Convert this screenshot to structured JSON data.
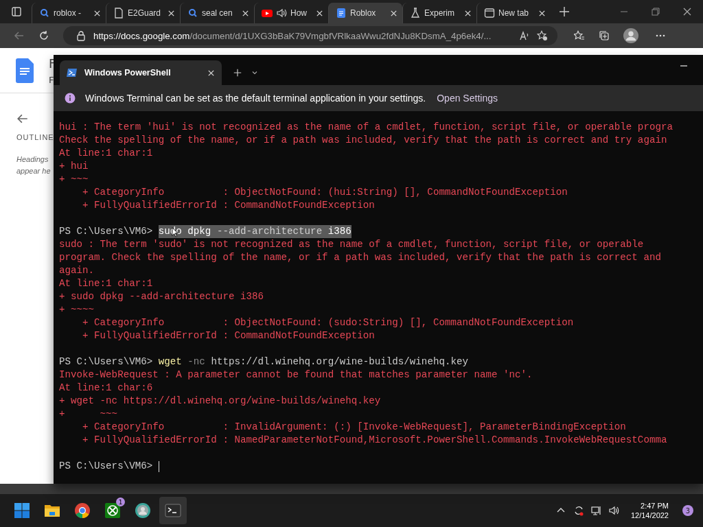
{
  "browser": {
    "tabs": [
      {
        "title": "roblox -",
        "kind": "search",
        "selected": false
      },
      {
        "title": "E2Guard",
        "kind": "page",
        "selected": false
      },
      {
        "title": "seal cen",
        "kind": "search",
        "selected": false
      },
      {
        "title": "How",
        "kind": "video",
        "selected": false
      },
      {
        "title": "Roblox",
        "kind": "doc",
        "selected": true
      },
      {
        "title": "Experim",
        "kind": "flask",
        "selected": false
      },
      {
        "title": "New tab",
        "kind": "newtab",
        "selected": false
      }
    ],
    "url_host": "https://docs.google.com",
    "url_path": "/document/d/1UXG3bBaK79VmgbfVRlkaaWwu2fdNJu8KDsmA_4p6ek4/..."
  },
  "docs": {
    "title_fragment": "F",
    "menu_fragment": "F",
    "outline_label": "OUTLINE",
    "outline_hint": [
      "Headings",
      "appear he"
    ]
  },
  "terminal": {
    "tab_title": "Windows PowerShell",
    "info": "Windows Terminal can be set as the default terminal application in your settings.",
    "info_action": "Open Settings",
    "lines": [
      {
        "kind": "error",
        "text": "hui : The term 'hui' is not recognized as the name of a cmdlet, function, script file, or operable progra"
      },
      {
        "kind": "error",
        "text": "Check the spelling of the name, or if a path was included, verify that the path is correct and try again"
      },
      {
        "kind": "error",
        "text": "At line:1 char:1"
      },
      {
        "kind": "error",
        "text": "+ hui"
      },
      {
        "kind": "error",
        "text": "+ ~~~"
      },
      {
        "kind": "error",
        "text": "    + CategoryInfo          : ObjectNotFound: (hui:String) [], CommandNotFoundException"
      },
      {
        "kind": "error",
        "text": "    + FullyQualifiedErrorId : CommandNotFoundException"
      },
      {
        "kind": "blank"
      },
      {
        "kind": "prompt",
        "prompt": "PS C:\\Users\\VM6>",
        "selected": true,
        "parts": [
          {
            "kind": "cmd",
            "text": "sudo"
          },
          {
            "kind": "arg",
            "text": "dpkg"
          },
          {
            "kind": "param",
            "text": "--add-architecture"
          },
          {
            "kind": "arg",
            "text": "i386"
          }
        ]
      },
      {
        "kind": "error",
        "text": "sudo : The term 'sudo' is not recognized as the name of a cmdlet, function, script file, or operable"
      },
      {
        "kind": "error",
        "text": "program. Check the spelling of the name, or if a path was included, verify that the path is correct and"
      },
      {
        "kind": "error",
        "text": "again."
      },
      {
        "kind": "error",
        "text": "At line:1 char:1"
      },
      {
        "kind": "error",
        "text": "+ sudo dpkg --add-architecture i386"
      },
      {
        "kind": "error",
        "text": "+ ~~~~"
      },
      {
        "kind": "error",
        "text": "    + CategoryInfo          : ObjectNotFound: (sudo:String) [], CommandNotFoundException"
      },
      {
        "kind": "error",
        "text": "    + FullyQualifiedErrorId : CommandNotFoundException"
      },
      {
        "kind": "blank"
      },
      {
        "kind": "prompt",
        "prompt": "PS C:\\Users\\VM6>",
        "selected": false,
        "parts": [
          {
            "kind": "cmd",
            "text": "wget"
          },
          {
            "kind": "param",
            "text": "-nc"
          },
          {
            "kind": "arg",
            "text": "https://dl.winehq.org/wine-builds/winehq.key"
          }
        ]
      },
      {
        "kind": "error",
        "text": "Invoke-WebRequest : A parameter cannot be found that matches parameter name 'nc'."
      },
      {
        "kind": "error",
        "text": "At line:1 char:6"
      },
      {
        "kind": "error",
        "text": "+ wget -nc https://dl.winehq.org/wine-builds/winehq.key"
      },
      {
        "kind": "error",
        "text": "+      ~~~"
      },
      {
        "kind": "error",
        "text": "    + CategoryInfo          : InvalidArgument: (:) [Invoke-WebRequest], ParameterBindingException"
      },
      {
        "kind": "error",
        "text": "    + FullyQualifiedErrorId : NamedParameterNotFound,Microsoft.PowerShell.Commands.InvokeWebRequestComma"
      },
      {
        "kind": "blank"
      },
      {
        "kind": "input",
        "prompt": "PS C:\\Users\\VM6>",
        "cursor": true
      }
    ]
  },
  "taskbar": {
    "apps": [
      {
        "kind": "start",
        "active": false
      },
      {
        "kind": "folder",
        "active": false
      },
      {
        "kind": "chrome",
        "active": false
      },
      {
        "kind": "xbox",
        "active": false,
        "badge": "1"
      },
      {
        "kind": "profile",
        "active": false
      },
      {
        "kind": "terminal",
        "active": true
      }
    ],
    "time": "2:47 PM",
    "date": "12/14/2022",
    "notifications": "3"
  }
}
